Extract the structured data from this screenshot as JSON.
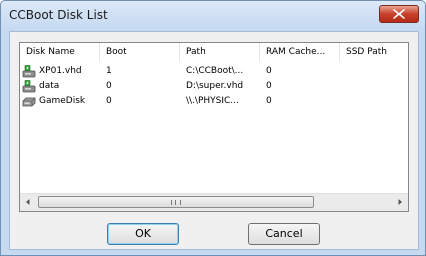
{
  "window": {
    "title": "CCBoot Disk List"
  },
  "list": {
    "columns": [
      "Disk Name",
      "Boot",
      "Path",
      "RAM Cache...",
      "SSD Path"
    ],
    "rows": [
      {
        "icon": "virtual-disk-green-icon",
        "name": "XP01.vhd",
        "boot": "1",
        "path": "C:\\CCBoot\\...",
        "ram_cache": "0",
        "ssd_path": ""
      },
      {
        "icon": "virtual-disk-green-icon",
        "name": "data",
        "boot": "0",
        "path": "D:\\super.vhd",
        "ram_cache": "0",
        "ssd_path": ""
      },
      {
        "icon": "physical-disk-icon",
        "name": "GameDisk",
        "boot": "0",
        "path": "\\\\.\\PHYSIC...",
        "ram_cache": "0",
        "ssd_path": ""
      }
    ]
  },
  "buttons": {
    "ok": "OK",
    "cancel": "Cancel"
  },
  "colors": {
    "titlebar": "#c5d9f1",
    "close_button": "#c8402c",
    "client": "#f0f0f0"
  }
}
